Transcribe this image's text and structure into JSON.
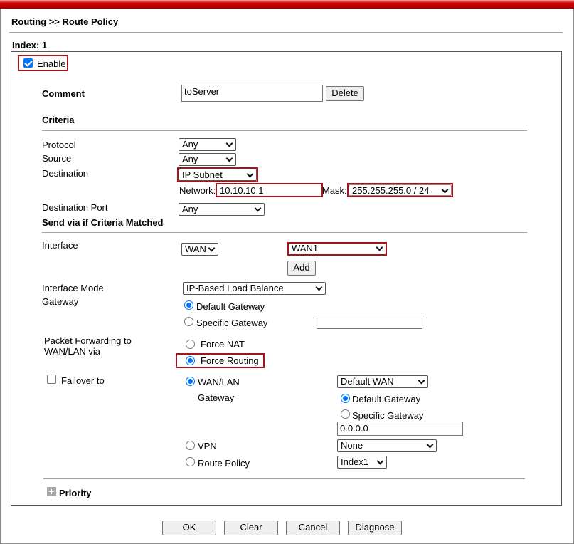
{
  "breadcrumb": "Routing >> Route Policy",
  "index_label": "Index: 1",
  "enable": {
    "label": "Enable",
    "checked": true
  },
  "comment": {
    "label": "Comment",
    "value": "toServer",
    "delete_label": "Delete"
  },
  "criteria": {
    "heading": "Criteria",
    "protocol": {
      "label": "Protocol",
      "value": "Any"
    },
    "source": {
      "label": "Source",
      "value": "Any"
    },
    "destination": {
      "label": "Destination",
      "value": "IP Subnet"
    },
    "network": {
      "label": "Network:",
      "value": "10.10.10.1"
    },
    "mask": {
      "label": "Mask:",
      "value": "255.255.255.0 / 24"
    },
    "destination_port": {
      "label": "Destination Port",
      "value": "Any"
    }
  },
  "send_via": {
    "heading": "Send via if Criteria Matched",
    "interface": {
      "label": "Interface",
      "type_value": "WAN",
      "wan_value": "WAN1",
      "add_label": "Add"
    },
    "interface_mode": {
      "label": "Interface Mode",
      "value": "IP-Based Load Balance"
    },
    "gateway": {
      "label": "Gateway",
      "default_label": "Default Gateway",
      "specific_label": "Specific Gateway",
      "specific_value": "",
      "selected": "default"
    },
    "packet_forwarding": {
      "label_line1": "Packet Forwarding to",
      "label_line2": "WAN/LAN via",
      "force_nat_label": "Force NAT",
      "force_routing_label": "Force Routing",
      "selected": "force_routing"
    },
    "failover": {
      "label": "Failover to",
      "checked": false,
      "wan_lan_label": "WAN/LAN",
      "wan_select_value": "Default WAN",
      "gateway_label": "Gateway",
      "default_gw_label": "Default Gateway",
      "specific_gw_label": "Specific Gateway",
      "specific_gw_value": "0.0.0.0",
      "vpn_label": "VPN",
      "vpn_value": "None",
      "route_policy_label": "Route Policy",
      "route_policy_value": "Index1",
      "selected": "wan_lan",
      "gateway_selected": "default"
    }
  },
  "priority": {
    "label": "Priority"
  },
  "buttons": {
    "ok": "OK",
    "clear": "Clear",
    "cancel": "Cancel",
    "diagnose": "Diagnose"
  },
  "colors": {
    "highlight": "#a4141c",
    "header_bar": "#c00000",
    "radio_checked": "#0075ff"
  }
}
